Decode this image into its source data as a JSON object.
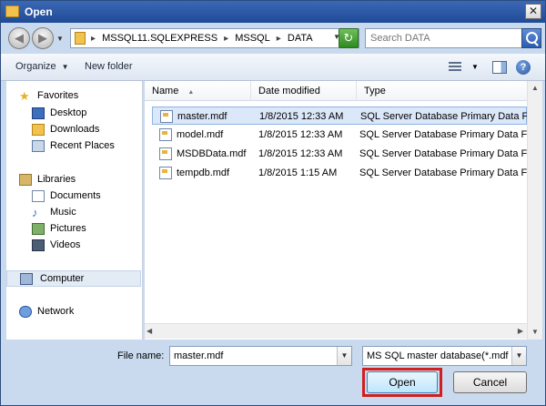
{
  "window": {
    "title": "Open",
    "close_glyph": "✕"
  },
  "nav": {
    "back_glyph": "◀",
    "forward_glyph": "▶",
    "breadcrumb": [
      "MSSQL11.SQLEXPRESS",
      "MSSQL",
      "DATA"
    ],
    "breadcrumb_sep": "▸",
    "dropdown_glyph": "▼",
    "refresh_glyph": "↻"
  },
  "search": {
    "placeholder": "Search DATA"
  },
  "toolbar": {
    "organize": "Organize",
    "new_folder": "New folder",
    "caret": "▼",
    "help": "?"
  },
  "sidebar": {
    "favorites": "Favorites",
    "desktop": "Desktop",
    "downloads": "Downloads",
    "recent": "Recent Places",
    "libraries": "Libraries",
    "documents": "Documents",
    "music": "Music",
    "pictures": "Pictures",
    "videos": "Videos",
    "computer": "Computer",
    "network": "Network",
    "star_glyph": "★",
    "note_glyph": "♪"
  },
  "columns": {
    "name": "Name",
    "date": "Date modified",
    "type": "Type",
    "sort_glyph": "▲"
  },
  "files": [
    {
      "name": "master.mdf",
      "date": "1/8/2015 12:33 AM",
      "type": "SQL Server Database Primary Data File"
    },
    {
      "name": "model.mdf",
      "date": "1/8/2015 12:33 AM",
      "type": "SQL Server Database Primary Data File"
    },
    {
      "name": "MSDBData.mdf",
      "date": "1/8/2015 12:33 AM",
      "type": "SQL Server Database Primary Data File"
    },
    {
      "name": "tempdb.mdf",
      "date": "1/8/2015 1:15 AM",
      "type": "SQL Server Database Primary Data File"
    }
  ],
  "scroll": {
    "up": "▲",
    "down": "▼",
    "left": "◀",
    "right": "▶"
  },
  "bottom": {
    "filename_label": "File name:",
    "filename_value": "master.mdf",
    "filter_value": "MS SQL master database(*.mdf",
    "dd_glyph": "▼",
    "open_label": "Open",
    "cancel_label": "Cancel"
  }
}
